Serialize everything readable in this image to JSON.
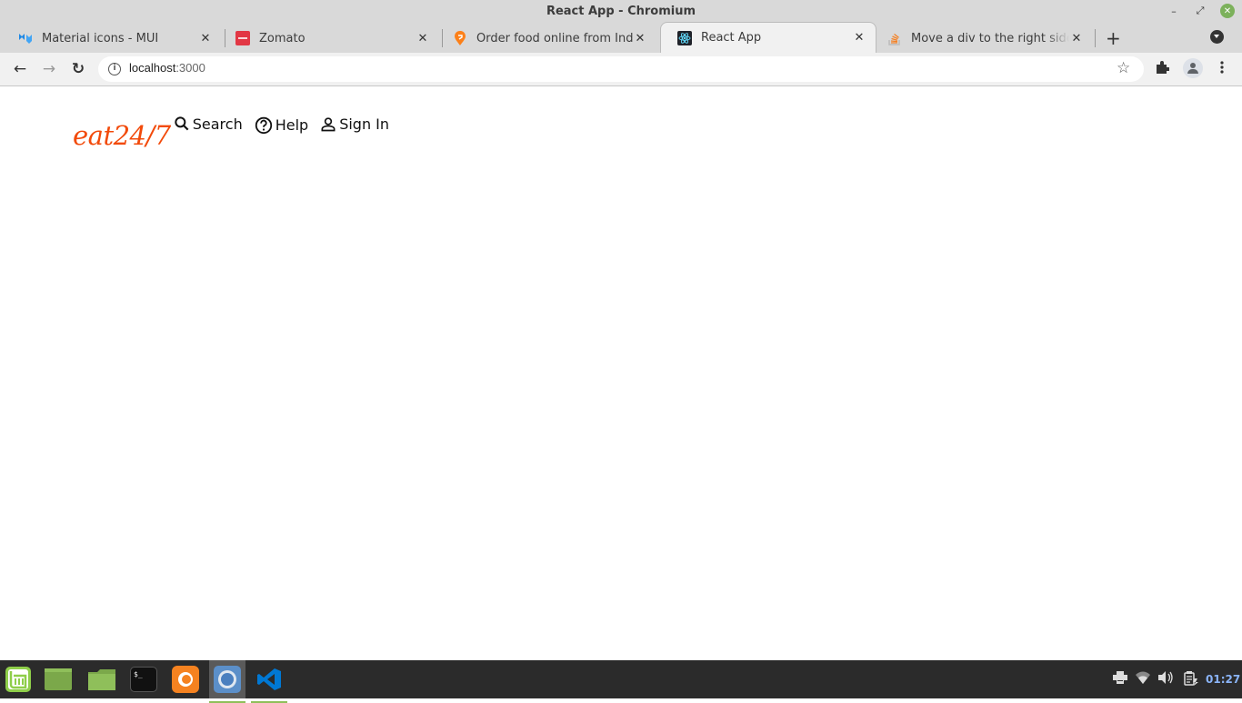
{
  "window": {
    "title": "React App - Chromium",
    "controls": {
      "minimize": "–",
      "maximize": "⤢",
      "close": "✕"
    }
  },
  "tabs": [
    {
      "title": "Material icons - MUI",
      "favicon": "mui-icon",
      "active": false
    },
    {
      "title": "Zomato",
      "favicon": "zomato-icon",
      "active": false
    },
    {
      "title": "Order food online from India's",
      "favicon": "swiggy-icon",
      "active": false
    },
    {
      "title": "React App",
      "favicon": "react-icon",
      "active": true
    },
    {
      "title": "Move a div to the right side of",
      "favicon": "stackoverflow-icon",
      "active": false
    }
  ],
  "tab_close_glyph": "✕",
  "new_tab_glyph": "+",
  "toolbar": {
    "back": "←",
    "forward": "→",
    "reload": "↻",
    "url_host": "localhost",
    "url_port": ":3000",
    "info_glyph": "i",
    "star_glyph": "☆",
    "extensions_glyph": "✚",
    "menu_glyph": "⋮"
  },
  "page": {
    "logo": "eat24/7",
    "nav": [
      {
        "label": "Search",
        "icon": "search-icon"
      },
      {
        "label": "Help",
        "icon": "help-icon"
      },
      {
        "label": "Sign In",
        "icon": "person-icon"
      }
    ]
  },
  "taskbar": {
    "apps": [
      "mint-menu",
      "files",
      "folder",
      "terminal",
      "firefox",
      "chromium",
      "vscode"
    ],
    "terminal_glyph": "$_",
    "clock": "01:27"
  }
}
